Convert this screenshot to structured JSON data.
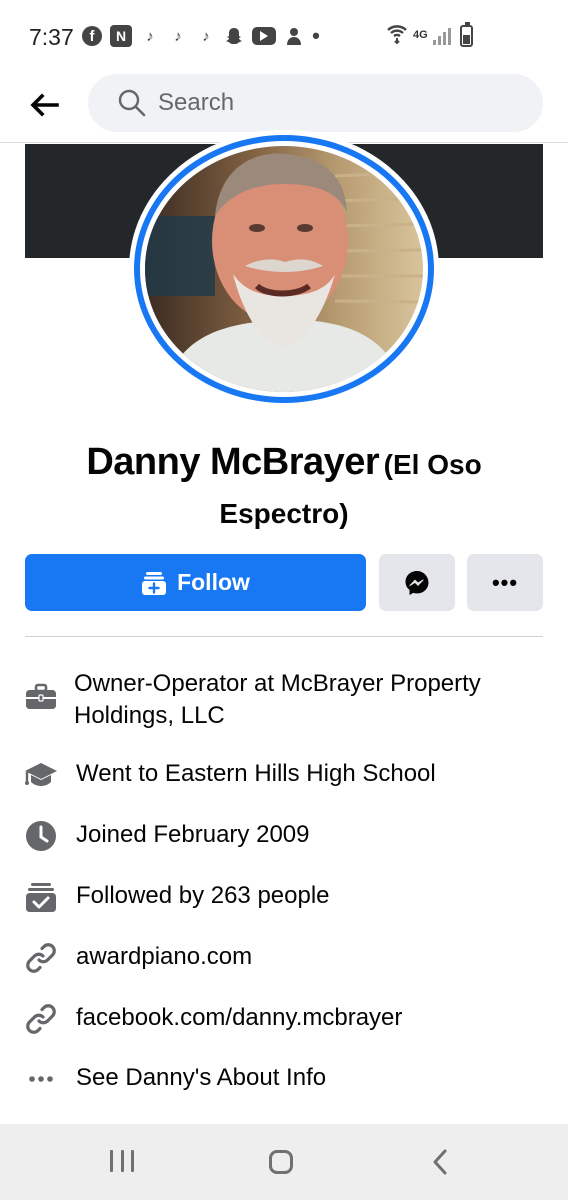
{
  "status_bar": {
    "time": "7:37",
    "network": "4G",
    "notification_icons": [
      "facebook-icon",
      "app-icon",
      "tiktok-icon",
      "tiktok-icon",
      "tiktok-icon",
      "snapchat-icon",
      "youtube-icon",
      "app-icon",
      "more-dot-icon"
    ]
  },
  "search": {
    "placeholder": "Search"
  },
  "profile": {
    "name": "Danny McBrayer",
    "alternate_name": "(El Oso Espectro)"
  },
  "actions": {
    "follow_label": "Follow",
    "more_label": "•••"
  },
  "details": {
    "work": "Owner-Operator at McBrayer Property Holdings, LLC",
    "education": "Went to Eastern Hills High School",
    "joined": "Joined February 2009",
    "followers": "Followed by 263 people",
    "website": "awardpiano.com",
    "profile_link": "facebook.com/danny.mcbrayer",
    "about": "See Danny's About Info"
  },
  "colors": {
    "brand_blue": "#1877f2",
    "icon_gray": "#65676b",
    "button_gray": "#e4e6eb",
    "cover_dark": "#23272a"
  }
}
